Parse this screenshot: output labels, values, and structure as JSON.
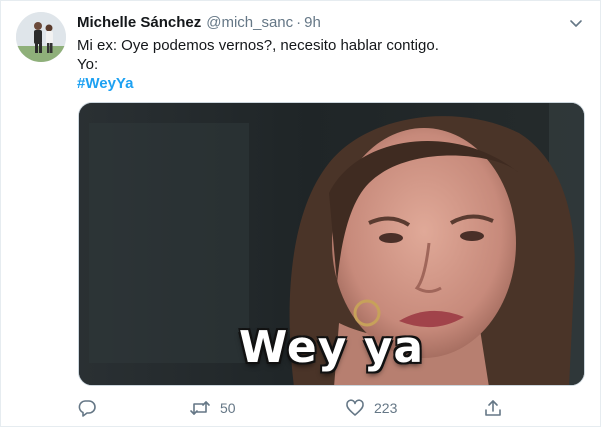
{
  "tweet": {
    "author_name": "Michelle Sánchez",
    "author_handle": "@mich_sanc",
    "separator": "·",
    "time": "9h",
    "lines": [
      "Mi ex: Oye podemos vernos?, necesito hablar contigo.",
      "Yo:"
    ],
    "hashtag": "#WeyYa",
    "media": {
      "caption": "Wey ya",
      "kind": "gif-still"
    },
    "actions": {
      "reply_icon": "reply-icon",
      "retweet_icon": "retweet-icon",
      "retweet_count": "50",
      "like_icon": "heart-icon",
      "like_count": "223",
      "share_icon": "share-icon"
    },
    "more_icon": "chevron-down-icon"
  },
  "colors": {
    "text": "#14171a",
    "secondary": "#657786",
    "link": "#1da1f2",
    "border": "#e6ecf0"
  }
}
